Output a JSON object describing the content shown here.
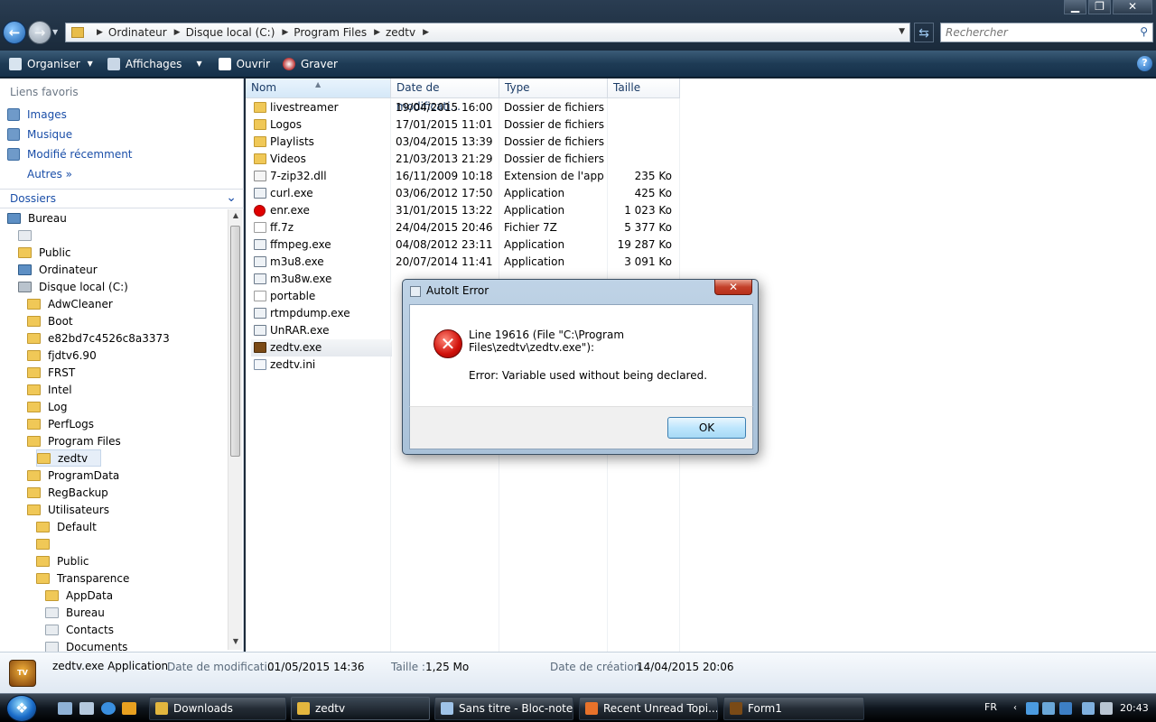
{
  "window": {
    "minimize": "▁",
    "maximize": "❐",
    "close": "✕"
  },
  "address": {
    "crumbs": [
      "Ordinateur",
      "Disque local (C:)",
      "Program Files",
      "zedtv"
    ],
    "search_placeholder": "Rechercher"
  },
  "toolbar": {
    "organiser": "Organiser",
    "affichages": "Affichages",
    "ouvrir": "Ouvrir",
    "graver": "Graver",
    "help": "?"
  },
  "favorites": {
    "title": "Liens favoris",
    "items": [
      "Images",
      "Musique",
      "Modifié récemment"
    ],
    "autres": "Autres"
  },
  "tree": {
    "header": "Dossiers",
    "items": [
      {
        "label": "Bureau",
        "icon": "desktop-icon",
        "indent": 0
      },
      {
        "label": "",
        "icon": "user-icon",
        "indent": 1
      },
      {
        "label": "Public",
        "icon": "folder-icon",
        "indent": 1
      },
      {
        "label": "Ordinateur",
        "icon": "computer-icon",
        "indent": 1
      },
      {
        "label": "Disque local (C:)",
        "icon": "drive-icon",
        "indent": 2
      },
      {
        "label": "AdwCleaner",
        "icon": "folder-icon",
        "indent": 3
      },
      {
        "label": "Boot",
        "icon": "folder-icon",
        "indent": 3
      },
      {
        "label": "e82bd7c4526c8a3373",
        "icon": "folder-icon",
        "indent": 3
      },
      {
        "label": "fjdtv6.90",
        "icon": "folder-icon",
        "indent": 3
      },
      {
        "label": "FRST",
        "icon": "folder-icon",
        "indent": 3
      },
      {
        "label": "Intel",
        "icon": "folder-icon",
        "indent": 3
      },
      {
        "label": "Log",
        "icon": "folder-icon",
        "indent": 3
      },
      {
        "label": "PerfLogs",
        "icon": "folder-icon",
        "indent": 3
      },
      {
        "label": "Program Files",
        "icon": "folder-icon",
        "indent": 3
      },
      {
        "label": "zedtv",
        "icon": "folder-icon",
        "indent": 4,
        "selected": true
      },
      {
        "label": "ProgramData",
        "icon": "folder-icon",
        "indent": 3
      },
      {
        "label": "RegBackup",
        "icon": "folder-icon",
        "indent": 3
      },
      {
        "label": "Utilisateurs",
        "icon": "folder-icon",
        "indent": 3
      },
      {
        "label": "Default",
        "icon": "folder-icon",
        "indent": 4
      },
      {
        "label": "",
        "icon": "folder-icon",
        "indent": 4
      },
      {
        "label": "Public",
        "icon": "folder-icon",
        "indent": 4
      },
      {
        "label": "Transparence",
        "icon": "folder-icon",
        "indent": 4
      },
      {
        "label": "AppData",
        "icon": "folder-icon",
        "indent": 5
      },
      {
        "label": "Bureau",
        "icon": "desktop-folder-icon",
        "indent": 5
      },
      {
        "label": "Contacts",
        "icon": "contacts-icon",
        "indent": 5
      },
      {
        "label": "Documents",
        "icon": "documents-icon",
        "indent": 5
      }
    ]
  },
  "columns": {
    "name": "Nom",
    "date": "Date de modificati...",
    "type": "Type",
    "size": "Taille"
  },
  "files": [
    {
      "name": "livestreamer",
      "date": "19/04/2015 16:00",
      "type": "Dossier de fichiers",
      "size": "",
      "icon": "folder"
    },
    {
      "name": "Logos",
      "date": "17/01/2015 11:01",
      "type": "Dossier de fichiers",
      "size": "",
      "icon": "folder"
    },
    {
      "name": "Playlists",
      "date": "03/04/2015 13:39",
      "type": "Dossier de fichiers",
      "size": "",
      "icon": "folder"
    },
    {
      "name": "Videos",
      "date": "21/03/2013 21:29",
      "type": "Dossier de fichiers",
      "size": "",
      "icon": "folder"
    },
    {
      "name": "7-zip32.dll",
      "date": "16/11/2009 10:18",
      "type": "Extension de l'app...",
      "size": "235 Ko",
      "icon": "dll"
    },
    {
      "name": "curl.exe",
      "date": "03/06/2012 17:50",
      "type": "Application",
      "size": "425 Ko",
      "icon": "app"
    },
    {
      "name": "enr.exe",
      "date": "31/01/2015 13:22",
      "type": "Application",
      "size": "1 023 Ko",
      "icon": "red"
    },
    {
      "name": "ff.7z",
      "date": "24/04/2015 20:46",
      "type": "Fichier 7Z",
      "size": "5 377 Ko",
      "icon": "file"
    },
    {
      "name": "ffmpeg.exe",
      "date": "04/08/2012 23:11",
      "type": "Application",
      "size": "19 287 Ko",
      "icon": "app"
    },
    {
      "name": "m3u8.exe",
      "date": "20/07/2014 11:41",
      "type": "Application",
      "size": "3 091 Ko",
      "icon": "app"
    },
    {
      "name": "m3u8w.exe",
      "date": "",
      "type": "",
      "size": "",
      "icon": "app"
    },
    {
      "name": "portable",
      "date": "",
      "type": "",
      "size": "",
      "icon": "file"
    },
    {
      "name": "rtmpdump.exe",
      "date": "",
      "type": "",
      "size": "",
      "icon": "app"
    },
    {
      "name": "UnRAR.exe",
      "date": "",
      "type": "",
      "size": "",
      "icon": "app"
    },
    {
      "name": "zedtv.exe",
      "date": "",
      "type": "",
      "size": "",
      "icon": "tv",
      "selected": true
    },
    {
      "name": "zedtv.ini",
      "date": "",
      "type": "",
      "size": "",
      "icon": "ini"
    }
  ],
  "dialog": {
    "title": "AutoIt Error",
    "close": "✕",
    "line1": "Line 19616  (File \"C:\\Program Files\\zedtv\\zedtv.exe\"):",
    "line2": "Error: Variable used without being declared.",
    "ok": "OK"
  },
  "details": {
    "name": "zedtv.exe Application",
    "date_label": "Date de modificati...",
    "date_value": "01/05/2015 14:36",
    "size_label": "Taille :",
    "size_value": "1,25 Mo",
    "created_label": "Date de création :",
    "created_value": "14/04/2015 20:06"
  },
  "taskbar": {
    "buttons": [
      {
        "label": "Downloads",
        "color": "#e3b63e"
      },
      {
        "label": "zedtv",
        "color": "#e3b63e",
        "active": true
      },
      {
        "label": "Sans titre - Bloc-notes",
        "color": "#9fc3e8"
      },
      {
        "label": "Recent Unread Topi...",
        "color": "#e8722a"
      },
      {
        "label": "Form1",
        "color": "#7a4a16"
      }
    ],
    "lang": "FR",
    "clock": "20:43"
  }
}
